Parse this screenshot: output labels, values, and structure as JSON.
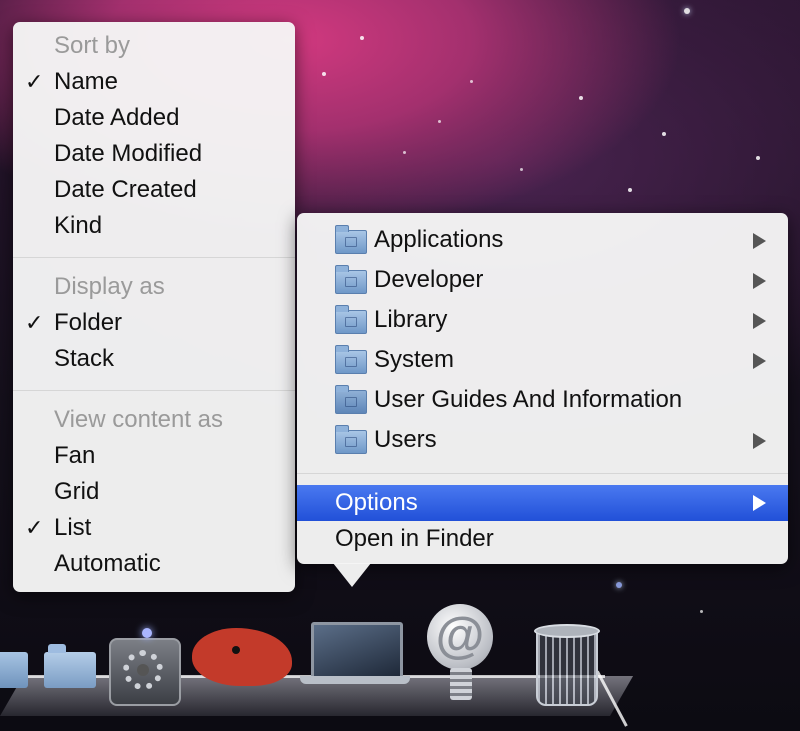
{
  "sort_menu": {
    "sort_header": "Sort by",
    "sort_items": [
      {
        "label": "Name",
        "checked": true
      },
      {
        "label": "Date Added",
        "checked": false
      },
      {
        "label": "Date Modified",
        "checked": false
      },
      {
        "label": "Date Created",
        "checked": false
      },
      {
        "label": "Kind",
        "checked": false
      }
    ],
    "display_header": "Display as",
    "display_items": [
      {
        "label": "Folder",
        "checked": true
      },
      {
        "label": "Stack",
        "checked": false
      }
    ],
    "view_header": "View content as",
    "view_items": [
      {
        "label": "Fan",
        "checked": false
      },
      {
        "label": "Grid",
        "checked": false
      },
      {
        "label": "List",
        "checked": true
      },
      {
        "label": "Automatic",
        "checked": false
      }
    ],
    "check_glyph": "✓"
  },
  "folder_menu": {
    "items": [
      {
        "label": "Applications",
        "icon": "folder-applications-icon",
        "submenu": true
      },
      {
        "label": "Developer",
        "icon": "folder-developer-icon",
        "submenu": true
      },
      {
        "label": "Library",
        "icon": "folder-library-icon",
        "submenu": true
      },
      {
        "label": "System",
        "icon": "folder-system-icon",
        "submenu": true
      },
      {
        "label": "User Guides And Information",
        "icon": "folder-alias-icon",
        "submenu": false
      },
      {
        "label": "Users",
        "icon": "folder-users-icon",
        "submenu": true
      }
    ],
    "options_label": "Options",
    "open_in_finder_label": "Open in Finder",
    "selected_color": "#2f5fe0"
  },
  "dock": {
    "mail_glyph": "@"
  }
}
